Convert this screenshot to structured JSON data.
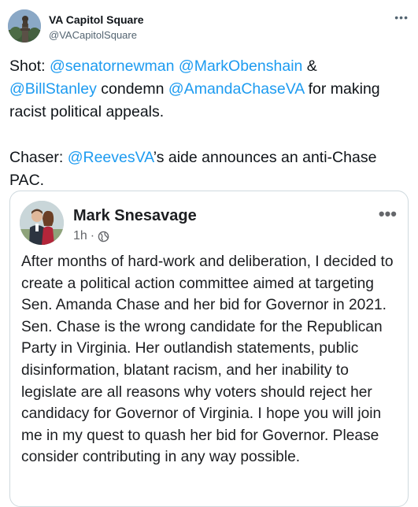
{
  "tweet": {
    "author_name": "VA Capitol Square",
    "author_handle": "@VACapitolSquare",
    "more_icon": "more-horizontal-icon",
    "text": {
      "p1_shot": "Shot: ",
      "p1_m1": "@senatornewman",
      "p1_sp1": " ",
      "p1_m2": "@MarkObenshain",
      "p1_amp": " & ",
      "p1_m3": "@BillStanley",
      "p1_condemn": " condemn ",
      "p1_m4": "@AmandaChaseVA",
      "p1_tail": " for making racist political appeals.",
      "p2_chaser": "Chaser: ",
      "p2_m5": "@ReevesVA",
      "p2_tail": "’s aide announces an anti-Chase PAC."
    }
  },
  "embedded_post": {
    "author_name": "Mark Snesavage",
    "time": "1h",
    "separator": "·",
    "privacy_icon": "globe-icon",
    "more_icon": "more-horizontal-icon",
    "body": "After months of hard-work and deliberation, I decided to create a political action committee aimed at targeting Sen. Amanda Chase and her bid for Governor in 2021. Sen. Chase is the wrong candidate for the Republican Party in Virginia. Her outlandish statements, public disinformation, blatant racism, and her inability to legislate are all reasons why voters should reject her candidacy for Governor of Virginia. I hope you will join me in my quest to quash her bid for Governor. Please consider contributing in any way possible."
  },
  "colors": {
    "link": "#1d9bf0",
    "text": "#0f1419",
    "secondary": "#536471",
    "border": "#cfd9de"
  }
}
